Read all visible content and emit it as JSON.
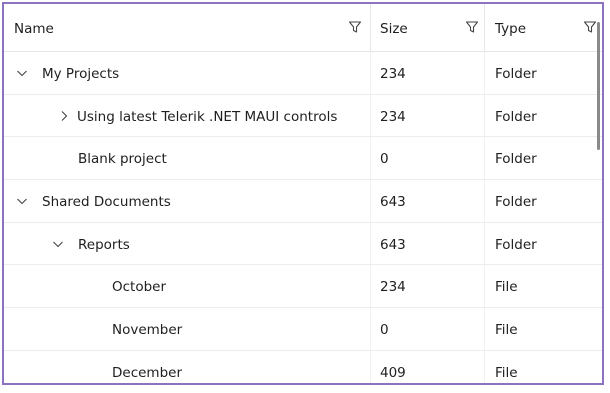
{
  "columns": [
    {
      "label": "Name"
    },
    {
      "label": "Size"
    },
    {
      "label": "Type"
    }
  ],
  "rows": [
    {
      "name": "My Projects",
      "size": "234",
      "type": "Folder",
      "level": 0,
      "expander": "expanded"
    },
    {
      "name": "Using latest Telerik .NET MAUI controls",
      "size": "234",
      "type": "Folder",
      "level": 1,
      "expander": "collapsed"
    },
    {
      "name": "Blank project",
      "size": "0",
      "type": "Folder",
      "level": 1,
      "expander": "none"
    },
    {
      "name": "Shared Documents",
      "size": "643",
      "type": "Folder",
      "level": 0,
      "expander": "expanded"
    },
    {
      "name": "Reports",
      "size": "643",
      "type": "Folder",
      "level": 1,
      "expander": "expanded"
    },
    {
      "name": "October",
      "size": "234",
      "type": "File",
      "level": 2,
      "expander": "none"
    },
    {
      "name": "November",
      "size": "0",
      "type": "File",
      "level": 2,
      "expander": "none"
    },
    {
      "name": "December",
      "size": "409",
      "type": "File",
      "level": 2,
      "expander": "none"
    }
  ],
  "colors": {
    "frame_border": "#8b73c1",
    "grid_line": "#e6e6e6",
    "text": "#1f1f1f",
    "icon": "#444444"
  },
  "icons": {
    "filter": "filter-icon",
    "expanded": "chevron-down-icon",
    "collapsed": "chevron-right-icon"
  }
}
